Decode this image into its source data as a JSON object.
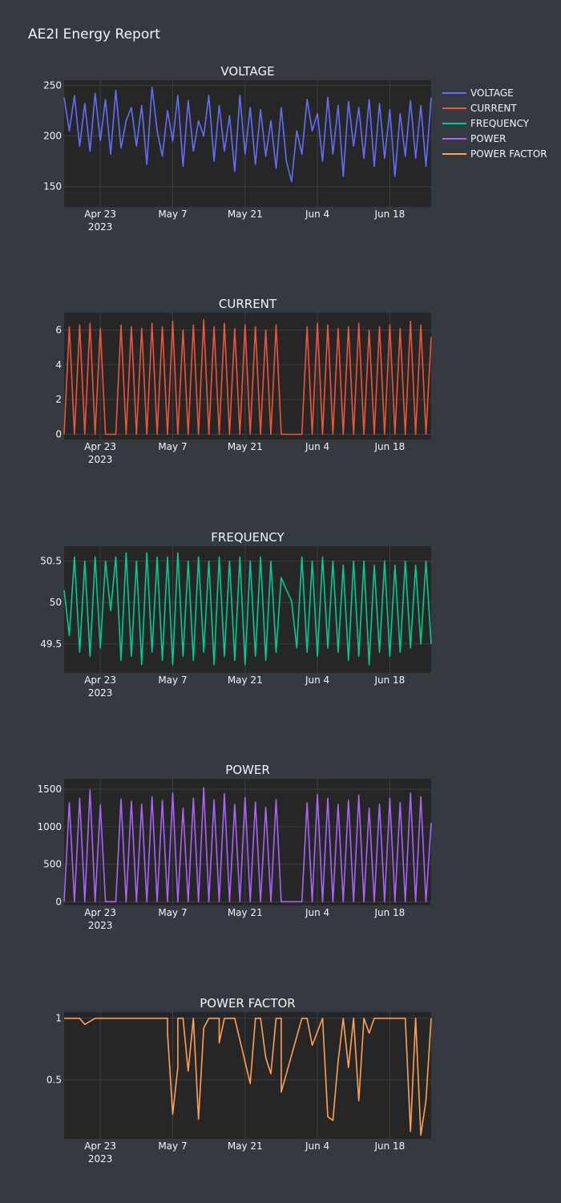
{
  "report": {
    "title": "AE2I Energy Report"
  },
  "legend": [
    {
      "name": "VOLTAGE",
      "color": "#636efa"
    },
    {
      "name": "CURRENT",
      "color": "#ef553b"
    },
    {
      "name": "FREQUENCY",
      "color": "#00cc96"
    },
    {
      "name": "POWER",
      "color": "#ab63fa"
    },
    {
      "name": "POWER FACTOR",
      "color": "#ffa15a"
    }
  ],
  "x_axis": {
    "range": [
      "2023-04-16",
      "2023-06-26"
    ],
    "ticks": [
      "2023-04-23",
      "2023-05-07",
      "2023-05-21",
      "2023-06-04",
      "2023-06-18"
    ],
    "tick_labels": [
      "Apr 23",
      "May 7",
      "May 21",
      "Jun 4",
      "Jun 18"
    ],
    "year_label": "2023"
  },
  "chart_data": [
    {
      "type": "line",
      "title": "VOLTAGE",
      "color": "#636efa",
      "ylim": [
        130,
        255
      ],
      "yticks": [
        150,
        200,
        250
      ],
      "ytick_labels": [
        "150",
        "200",
        "250"
      ],
      "grid": true,
      "series": [
        {
          "name": "VOLTAGE",
          "x": [
            "2023-04-16",
            "2023-04-17",
            "2023-04-18",
            "2023-04-19",
            "2023-04-20",
            "2023-04-21",
            "2023-04-22",
            "2023-04-23",
            "2023-04-24",
            "2023-04-25",
            "2023-04-26",
            "2023-04-27",
            "2023-04-28",
            "2023-04-29",
            "2023-04-30",
            "2023-05-01",
            "2023-05-02",
            "2023-05-03",
            "2023-05-04",
            "2023-05-05",
            "2023-05-06",
            "2023-05-07",
            "2023-05-08",
            "2023-05-09",
            "2023-05-10",
            "2023-05-11",
            "2023-05-12",
            "2023-05-13",
            "2023-05-14",
            "2023-05-15",
            "2023-05-16",
            "2023-05-17",
            "2023-05-18",
            "2023-05-19",
            "2023-05-20",
            "2023-05-21",
            "2023-05-22",
            "2023-05-23",
            "2023-05-24",
            "2023-05-25",
            "2023-05-26",
            "2023-05-27",
            "2023-05-28",
            "2023-05-29",
            "2023-05-30",
            "2023-05-31",
            "2023-06-01",
            "2023-06-02",
            "2023-06-03",
            "2023-06-04",
            "2023-06-05",
            "2023-06-06",
            "2023-06-07",
            "2023-06-08",
            "2023-06-09",
            "2023-06-10",
            "2023-06-11",
            "2023-06-12",
            "2023-06-13",
            "2023-06-14",
            "2023-06-15",
            "2023-06-16",
            "2023-06-17",
            "2023-06-18",
            "2023-06-19",
            "2023-06-20",
            "2023-06-21",
            "2023-06-22",
            "2023-06-23",
            "2023-06-24",
            "2023-06-25",
            "2023-06-26"
          ],
          "y": [
            238,
            205,
            240,
            190,
            232,
            185,
            242,
            195,
            236,
            182,
            245,
            188,
            215,
            228,
            190,
            230,
            172,
            248,
            205,
            180,
            225,
            195,
            240,
            170,
            235,
            185,
            215,
            200,
            240,
            175,
            230,
            185,
            220,
            165,
            240,
            182,
            228,
            172,
            226,
            180,
            215,
            168,
            228,
            175,
            155,
            205,
            182,
            236,
            205,
            222,
            175,
            238,
            182,
            230,
            160,
            234,
            190,
            228,
            178,
            236,
            170,
            232,
            178,
            226,
            160,
            222,
            180,
            235,
            178,
            230,
            170,
            238
          ]
        }
      ]
    },
    {
      "type": "line",
      "title": "CURRENT",
      "color": "#ef553b",
      "ylim": [
        -0.3,
        7
      ],
      "yticks": [
        0,
        2,
        4,
        6
      ],
      "ytick_labels": [
        "0",
        "2",
        "4",
        "6"
      ],
      "grid": true,
      "series": [
        {
          "name": "CURRENT",
          "x": [
            "2023-04-16",
            "2023-04-17",
            "2023-04-18",
            "2023-04-19",
            "2023-04-20",
            "2023-04-21",
            "2023-04-22",
            "2023-04-23",
            "2023-04-24",
            "2023-04-25",
            "2023-04-26",
            "2023-04-27",
            "2023-04-28",
            "2023-04-29",
            "2023-04-30",
            "2023-05-01",
            "2023-05-02",
            "2023-05-03",
            "2023-05-04",
            "2023-05-05",
            "2023-05-06",
            "2023-05-07",
            "2023-05-08",
            "2023-05-09",
            "2023-05-10",
            "2023-05-11",
            "2023-05-12",
            "2023-05-13",
            "2023-05-14",
            "2023-05-15",
            "2023-05-16",
            "2023-05-17",
            "2023-05-18",
            "2023-05-19",
            "2023-05-20",
            "2023-05-21",
            "2023-05-22",
            "2023-05-23",
            "2023-05-24",
            "2023-05-25",
            "2023-05-26",
            "2023-05-27",
            "2023-05-28",
            "2023-05-29",
            "2023-05-30",
            "2023-05-31",
            "2023-06-01",
            "2023-06-02",
            "2023-06-03",
            "2023-06-04",
            "2023-06-05",
            "2023-06-06",
            "2023-06-07",
            "2023-06-08",
            "2023-06-09",
            "2023-06-10",
            "2023-06-11",
            "2023-06-12",
            "2023-06-13",
            "2023-06-14",
            "2023-06-15",
            "2023-06-16",
            "2023-06-17",
            "2023-06-18",
            "2023-06-19",
            "2023-06-20",
            "2023-06-21",
            "2023-06-22",
            "2023-06-23",
            "2023-06-24",
            "2023-06-25",
            "2023-06-26"
          ],
          "y": [
            0,
            6.2,
            0,
            6.3,
            0,
            6.4,
            0,
            6.1,
            0,
            0,
            0,
            6.3,
            0,
            6.2,
            0,
            6.1,
            0,
            6.4,
            0,
            6.2,
            0,
            6.5,
            0,
            6.0,
            0,
            6.3,
            0,
            6.6,
            0,
            6.2,
            0,
            6.4,
            0,
            6.1,
            0,
            6.3,
            0,
            6.2,
            0,
            6.0,
            0,
            6.3,
            0,
            0,
            0,
            0,
            0,
            6.2,
            0,
            6.4,
            0,
            6.3,
            0,
            6.1,
            0,
            6.2,
            0,
            6.4,
            0,
            6.0,
            0,
            6.2,
            0,
            6.3,
            0,
            6.1,
            0,
            6.5,
            0,
            6.3,
            0,
            5.6
          ]
        }
      ]
    },
    {
      "type": "line",
      "title": "FREQUENCY",
      "color": "#00cc96",
      "ylim": [
        49.15,
        50.68
      ],
      "yticks": [
        49.5,
        50,
        50.5
      ],
      "ytick_labels": [
        "49.5",
        "50",
        "50.5"
      ],
      "grid": true,
      "series": [
        {
          "name": "FREQUENCY",
          "x": [
            "2023-04-16",
            "2023-04-17",
            "2023-04-18",
            "2023-04-19",
            "2023-04-20",
            "2023-04-21",
            "2023-04-22",
            "2023-04-23",
            "2023-04-24",
            "2023-04-25",
            "2023-04-26",
            "2023-04-27",
            "2023-04-28",
            "2023-04-29",
            "2023-04-30",
            "2023-05-01",
            "2023-05-02",
            "2023-05-03",
            "2023-05-04",
            "2023-05-05",
            "2023-05-06",
            "2023-05-07",
            "2023-05-08",
            "2023-05-09",
            "2023-05-10",
            "2023-05-11",
            "2023-05-12",
            "2023-05-13",
            "2023-05-14",
            "2023-05-15",
            "2023-05-16",
            "2023-05-17",
            "2023-05-18",
            "2023-05-19",
            "2023-05-20",
            "2023-05-21",
            "2023-05-22",
            "2023-05-23",
            "2023-05-24",
            "2023-05-25",
            "2023-05-26",
            "2023-05-27",
            "2023-05-28",
            "2023-05-29",
            "2023-05-30",
            "2023-05-31",
            "2023-06-01",
            "2023-06-02",
            "2023-06-03",
            "2023-06-04",
            "2023-06-05",
            "2023-06-06",
            "2023-06-07",
            "2023-06-08",
            "2023-06-09",
            "2023-06-10",
            "2023-06-11",
            "2023-06-12",
            "2023-06-13",
            "2023-06-14",
            "2023-06-15",
            "2023-06-16",
            "2023-06-17",
            "2023-06-18",
            "2023-06-19",
            "2023-06-20",
            "2023-06-21",
            "2023-06-22",
            "2023-06-23",
            "2023-06-24",
            "2023-06-25",
            "2023-06-26"
          ],
          "y": [
            50.15,
            49.6,
            50.55,
            49.4,
            50.5,
            49.35,
            50.55,
            49.45,
            50.5,
            49.9,
            50.55,
            49.3,
            50.6,
            49.35,
            50.5,
            49.25,
            50.6,
            49.4,
            50.55,
            49.3,
            50.55,
            49.25,
            50.6,
            49.35,
            50.5,
            49.3,
            50.55,
            49.4,
            50.5,
            49.25,
            50.55,
            49.35,
            50.5,
            49.3,
            50.55,
            49.25,
            50.5,
            49.35,
            50.55,
            49.3,
            50.5,
            49.4,
            50.3,
            50.15,
            50.02,
            49.45,
            50.55,
            49.4,
            50.5,
            49.35,
            50.55,
            49.45,
            50.5,
            49.4,
            50.45,
            49.3,
            50.5,
            49.35,
            50.5,
            49.25,
            50.45,
            49.4,
            50.5,
            49.35,
            50.45,
            49.4,
            50.5,
            49.45,
            50.45,
            49.5,
            50.5,
            49.5
          ]
        }
      ]
    },
    {
      "type": "line",
      "title": "POWER",
      "color": "#ab63fa",
      "ylim": [
        -50,
        1640
      ],
      "yticks": [
        0,
        500,
        1000,
        1500
      ],
      "ytick_labels": [
        "0",
        "500",
        "1000",
        "1500"
      ],
      "grid": true,
      "series": [
        {
          "name": "POWER",
          "x": [
            "2023-04-16",
            "2023-04-17",
            "2023-04-18",
            "2023-04-19",
            "2023-04-20",
            "2023-04-21",
            "2023-04-22",
            "2023-04-23",
            "2023-04-24",
            "2023-04-25",
            "2023-04-26",
            "2023-04-27",
            "2023-04-28",
            "2023-04-29",
            "2023-04-30",
            "2023-05-01",
            "2023-05-02",
            "2023-05-03",
            "2023-05-04",
            "2023-05-05",
            "2023-05-06",
            "2023-05-07",
            "2023-05-08",
            "2023-05-09",
            "2023-05-10",
            "2023-05-11",
            "2023-05-12",
            "2023-05-13",
            "2023-05-14",
            "2023-05-15",
            "2023-05-16",
            "2023-05-17",
            "2023-05-18",
            "2023-05-19",
            "2023-05-20",
            "2023-05-21",
            "2023-05-22",
            "2023-05-23",
            "2023-05-24",
            "2023-05-25",
            "2023-05-26",
            "2023-05-27",
            "2023-05-28",
            "2023-05-29",
            "2023-05-30",
            "2023-05-31",
            "2023-06-01",
            "2023-06-02",
            "2023-06-03",
            "2023-06-04",
            "2023-06-05",
            "2023-06-06",
            "2023-06-07",
            "2023-06-08",
            "2023-06-09",
            "2023-06-10",
            "2023-06-11",
            "2023-06-12",
            "2023-06-13",
            "2023-06-14",
            "2023-06-15",
            "2023-06-16",
            "2023-06-17",
            "2023-06-18",
            "2023-06-19",
            "2023-06-20",
            "2023-06-21",
            "2023-06-22",
            "2023-06-23",
            "2023-06-24",
            "2023-06-25",
            "2023-06-26"
          ],
          "y": [
            0,
            1320,
            0,
            1380,
            0,
            1490,
            0,
            1290,
            0,
            0,
            0,
            1370,
            0,
            1340,
            0,
            1300,
            0,
            1400,
            0,
            1350,
            0,
            1450,
            0,
            1250,
            0,
            1380,
            0,
            1520,
            0,
            1360,
            0,
            1440,
            0,
            1300,
            0,
            1390,
            0,
            1330,
            0,
            1260,
            0,
            1360,
            0,
            0,
            0,
            0,
            0,
            1320,
            0,
            1430,
            0,
            1380,
            0,
            1300,
            0,
            1350,
            0,
            1420,
            0,
            1250,
            0,
            1300,
            0,
            1380,
            0,
            1320,
            0,
            1450,
            0,
            1400,
            0,
            1050
          ]
        }
      ]
    },
    {
      "type": "line",
      "title": "POWER FACTOR",
      "color": "#ffa15a",
      "ylim": [
        0.02,
        1.05
      ],
      "yticks": [
        0.5,
        1
      ],
      "ytick_labels": [
        "0.5",
        "1"
      ],
      "grid": true,
      "series": [
        {
          "name": "POWER FACTOR",
          "x": [
            "2023-04-16",
            "2023-04-19",
            "2023-04-20",
            "2023-04-22",
            "2023-04-23",
            "2023-04-24",
            "2023-04-26",
            "2023-04-27",
            "2023-05-01",
            "2023-05-02",
            "2023-05-03",
            "2023-05-06",
            "2023-05-06",
            "2023-05-07",
            "2023-05-08",
            "2023-05-08",
            "2023-05-09",
            "2023-05-10",
            "2023-05-11",
            "2023-05-11",
            "2023-05-12",
            "2023-05-13",
            "2023-05-14",
            "2023-05-15",
            "2023-05-16",
            "2023-05-16",
            "2023-05-17",
            "2023-05-18",
            "2023-05-19",
            "2023-05-22",
            "2023-05-23",
            "2023-05-24",
            "2023-05-25",
            "2023-05-26",
            "2023-05-27",
            "2023-05-28",
            "2023-05-28",
            "2023-06-01",
            "2023-06-02",
            "2023-06-03",
            "2023-06-05",
            "2023-06-06",
            "2023-06-07",
            "2023-06-08",
            "2023-06-09",
            "2023-06-10",
            "2023-06-11",
            "2023-06-12",
            "2023-06-13",
            "2023-06-14",
            "2023-06-15",
            "2023-06-16",
            "2023-06-17",
            "2023-06-19",
            "2023-06-21",
            "2023-06-22",
            "2023-06-23",
            "2023-06-24",
            "2023-06-25",
            "2023-06-26"
          ],
          "y": [
            1,
            1,
            0.95,
            1,
            1,
            1,
            1,
            1,
            1,
            1,
            1,
            1,
            0.88,
            0.22,
            0.6,
            1,
            1,
            0.57,
            1,
            1,
            0.18,
            0.92,
            1,
            1,
            1,
            0.8,
            1,
            1,
            1,
            0.47,
            1,
            1,
            0.68,
            0.55,
            1,
            1,
            0.4,
            1,
            1,
            0.78,
            1,
            0.2,
            0.17,
            0.65,
            1,
            0.6,
            1,
            0.33,
            1,
            0.88,
            1,
            1,
            1,
            1,
            1,
            0.08,
            1,
            0.05,
            0.33,
            1
          ]
        }
      ]
    }
  ]
}
